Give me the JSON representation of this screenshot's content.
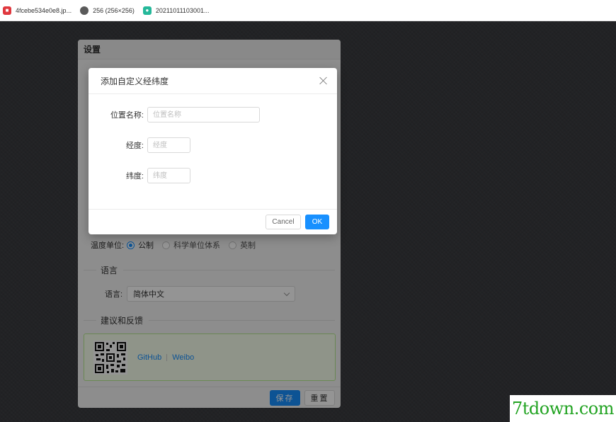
{
  "bookmarks": [
    {
      "label": "4fcebe534e0e8.jp...",
      "icon": "pdf-icon"
    },
    {
      "label": "256 (256×256)",
      "icon": "globe-icon"
    },
    {
      "label": "20211011103001...",
      "icon": "app-icon"
    }
  ],
  "settings": {
    "title": "设置",
    "temperature": {
      "label": "温度单位:",
      "options": [
        "公制",
        "科学单位体系",
        "英制"
      ],
      "selected": "公制"
    },
    "language_section": "语言",
    "language": {
      "label": "语言:",
      "value": "简体中文"
    },
    "feedback_section": "建议和反馈",
    "links": {
      "github": "GitHub",
      "weibo": "Weibo"
    },
    "save_label": "保存",
    "reset_label": "重置"
  },
  "modal": {
    "title": "添加自定义经纬度",
    "name_label": "位置名称:",
    "name_placeholder": "位置名称",
    "lng_label": "经度:",
    "lng_placeholder": "经度",
    "lat_label": "纬度:",
    "lat_placeholder": "纬度",
    "cancel_label": "Cancel",
    "ok_label": "OK"
  },
  "watermark": "7tdown.com",
  "colors": {
    "primary": "#1890ff",
    "overlay": "rgba(0,0,0,0.42)",
    "feedback_bg": "#f6ffed"
  }
}
